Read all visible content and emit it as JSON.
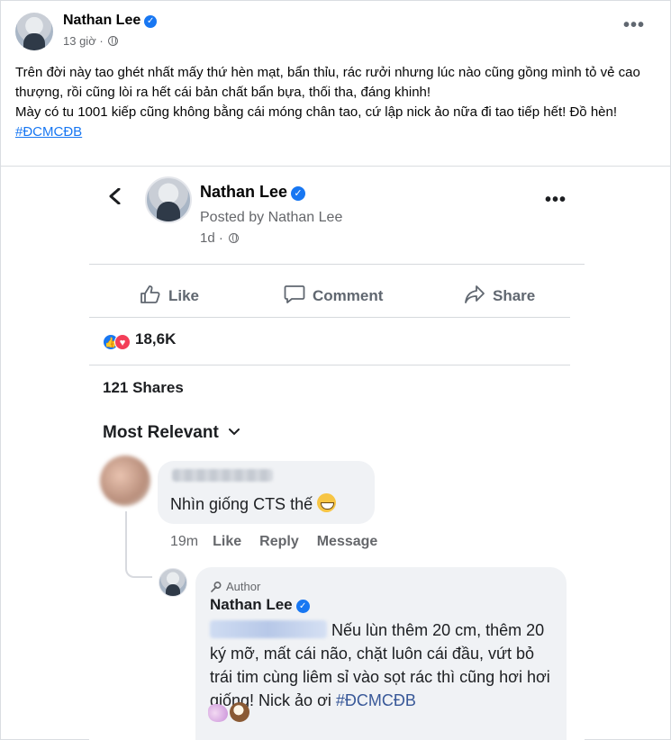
{
  "post": {
    "author_name": "Nathan Lee",
    "time": "13 giờ",
    "more_icon": "more-dots-icon",
    "text_line_1": "Trên đời này tao ghét nhất mấy thứ hèn mạt, bẩn thỉu, rác rưởi nhưng lúc nào cũng gồng mình tỏ vẻ cao thượng, rồi cũng lòi ra hết cái bản chất bẩn bựa, thối tha, đáng khinh!",
    "text_line_2": "Mày có tu 1001 kiếp cũng không bằng cái móng chân tao, cứ lập nick ảo nữa đi tao tiếp hết! Đồ hèn!",
    "hashtag": "#ĐCMCĐB"
  },
  "embedded": {
    "author_name": "Nathan Lee",
    "posted_by": "Posted by Nathan Lee",
    "time": "1d ·",
    "actions": {
      "like": "Like",
      "comment": "Comment",
      "share": "Share"
    },
    "reaction_count": "18,6K",
    "shares": "121 Shares",
    "sort_label": "Most Relevant",
    "comment_1": {
      "text": "Nhìn giống CTS thế",
      "time": "19m",
      "like": "Like",
      "reply": "Reply",
      "message": "Message"
    },
    "comment_2": {
      "author_tag": "Author",
      "author_name": "Nathan Lee",
      "text_1": "Nếu lùn thêm 20 cm, thêm 20 ký mỡ, mất cái não, chặt luôn cái đầu, vứt bỏ trái tim cùng liêm sỉ vào sọt rác thì cũng hơi hơi giống! Nick ảo ơi ",
      "hashtag": "#ĐCMCĐB"
    }
  },
  "colors": {
    "brand_blue": "#1877f2",
    "love_red": "#f33e58",
    "bubble_gray": "#f0f2f5",
    "secondary_text": "#65676b"
  }
}
